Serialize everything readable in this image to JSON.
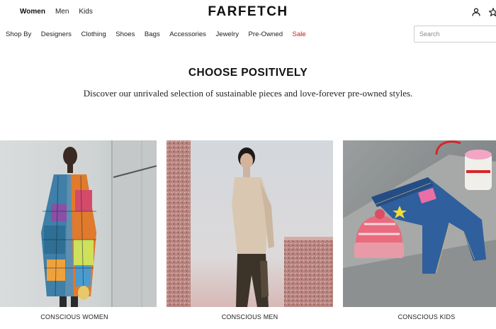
{
  "header": {
    "logo": "FARFETCH",
    "gender_tabs": [
      "Women",
      "Men",
      "Kids"
    ],
    "active_gender": "Women"
  },
  "nav": {
    "items": [
      "Shop By",
      "Designers",
      "Clothing",
      "Shoes",
      "Bags",
      "Accessories",
      "Jewelry",
      "Pre-Owned",
      "Sale"
    ]
  },
  "search": {
    "placeholder": "Search"
  },
  "hero": {
    "title": "CHOOSE POSITIVELY",
    "subtitle": "Discover our unrivaled selection of sustainable pieces and love-forever pre-owned styles."
  },
  "tiles": [
    {
      "label": "CONSCIOUS WOMEN"
    },
    {
      "label": "CONSCIOUS MEN"
    },
    {
      "label": "CONSCIOUS KIDS"
    }
  ],
  "colors": {
    "sale": "#c21b1b",
    "text": "#222222"
  },
  "icons": [
    "user-icon",
    "wishlist-star-icon"
  ]
}
